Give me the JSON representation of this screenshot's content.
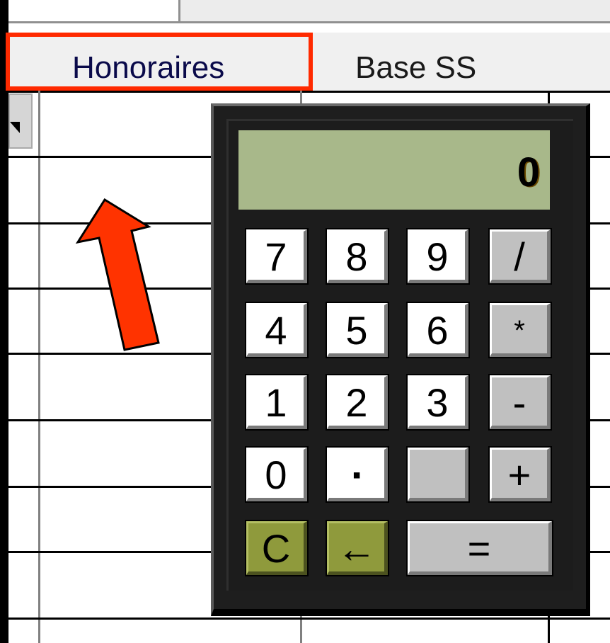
{
  "spreadsheet": {
    "columns": [
      {
        "label": "Honoraires"
      },
      {
        "label": "Base SS"
      }
    ]
  },
  "calculator": {
    "display": "0",
    "rows": [
      [
        "7",
        "8",
        "9",
        "/"
      ],
      [
        "4",
        "5",
        "6",
        "*"
      ],
      [
        "1",
        "2",
        "3",
        "-"
      ],
      [
        "0",
        "▪",
        "",
        "+"
      ],
      [
        "C",
        "←",
        "="
      ]
    ]
  },
  "annotation": {
    "highlight_color": "#ff2a00",
    "arrow_color": "#ff3300"
  }
}
